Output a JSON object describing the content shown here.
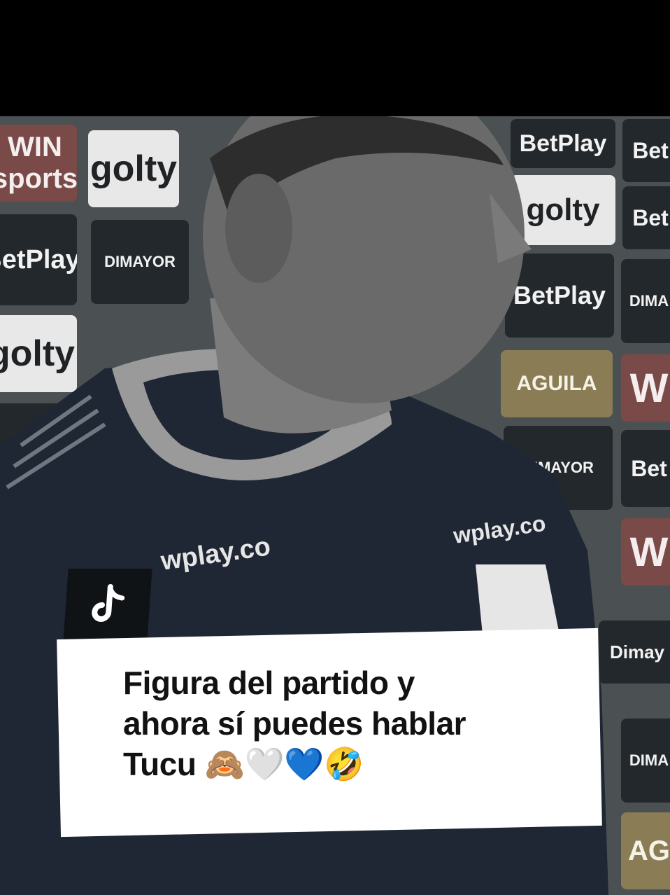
{
  "video": {
    "sponsor_boards": [
      "WIN sports",
      "golty",
      "BetPlay",
      "Bet",
      "BetPlay",
      "DIMAYOR",
      "golty",
      "BetPlay",
      "DIMA",
      "AGUILA",
      "W",
      "DIMAYOR",
      "Bet",
      "W",
      "Dimay",
      "DIMA",
      "AG"
    ],
    "shirt_sponsor_left": "wplay.co",
    "shirt_sponsor_right": "wplay.co"
  },
  "overlay": {
    "logo_icon": "tiktok-icon",
    "caption_lines": [
      "Figura del partido y",
      "ahora sí puedes hablar",
      "Tucu 🙈🤍💙🤣"
    ]
  },
  "colors": {
    "background": "#000000",
    "caption_bg": "#ffffff",
    "caption_text": "#121212",
    "logo_bg": "#101316"
  }
}
